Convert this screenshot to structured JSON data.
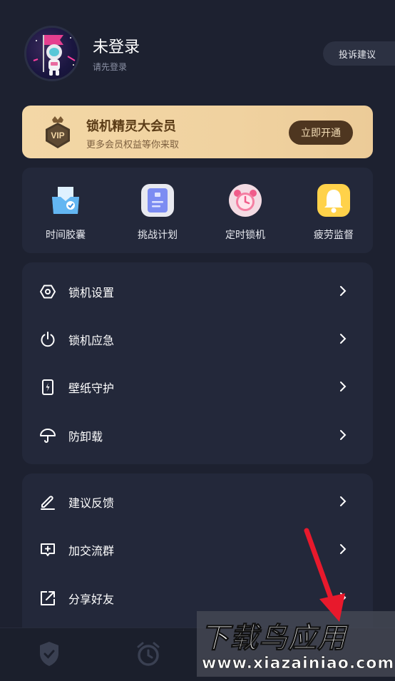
{
  "profile": {
    "name": "未登录",
    "sub": "请先登录",
    "feedback_button": "投诉建议"
  },
  "vip": {
    "badge_text": "VIP",
    "title": "锁机精灵大会员",
    "subtitle": "更多会员权益等你来取",
    "button": "立即开通"
  },
  "tools": [
    {
      "label": "时间胶囊",
      "icon": "capsule-icon"
    },
    {
      "label": "挑战计划",
      "icon": "clipboard-icon"
    },
    {
      "label": "定时锁机",
      "icon": "alarm-clock-icon"
    },
    {
      "label": "疲劳监督",
      "icon": "bell-icon"
    }
  ],
  "settings": [
    {
      "label": "锁机设置",
      "icon": "hexagon-gear-icon"
    },
    {
      "label": "锁机应急",
      "icon": "power-icon"
    },
    {
      "label": "壁纸守护",
      "icon": "phone-bolt-icon"
    },
    {
      "label": "防卸载",
      "icon": "umbrella-icon"
    }
  ],
  "more": [
    {
      "label": "建议反馈",
      "icon": "pencil-icon"
    },
    {
      "label": "加交流群",
      "icon": "chat-plus-icon"
    },
    {
      "label": "分享好友",
      "icon": "share-icon"
    }
  ],
  "bottom_nav": [
    "shield-check-icon",
    "alarm-clock-icon"
  ],
  "watermark": {
    "top": "下载鸟应用",
    "bottom": "www.xiazainiao.com"
  },
  "colors": {
    "background": "#1d2130",
    "card": "#23283a",
    "vip_gold": "#f3d7a6",
    "vip_button": "#4e3620",
    "arrow_red": "#e8192c"
  }
}
